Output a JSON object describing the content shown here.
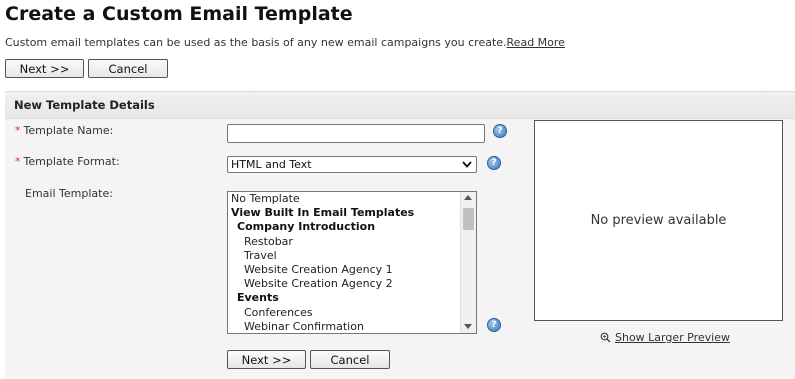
{
  "page": {
    "title": "Create a Custom Email Template",
    "description": "Custom email templates can be used as the basis of any new email campaigns you create.",
    "read_more": "Read More"
  },
  "top_buttons": {
    "next": "Next >>",
    "cancel": "Cancel"
  },
  "panel": {
    "header": "New Template Details"
  },
  "form": {
    "required_mark": "*",
    "template_name_label": "Template Name:",
    "template_name_value": "",
    "template_format_label": "Template Format:",
    "template_format_value": "HTML and Text",
    "email_template_label": "Email Template:",
    "email_template_options": [
      {
        "text": "No Template",
        "type": "item"
      },
      {
        "text": "View Built In Email Templates",
        "type": "group"
      },
      {
        "text": "Company Introduction",
        "type": "subgroup"
      },
      {
        "text": "Restobar",
        "type": "leaf"
      },
      {
        "text": "Travel",
        "type": "leaf"
      },
      {
        "text": "Website Creation Agency 1",
        "type": "leaf"
      },
      {
        "text": "Website Creation Agency 2",
        "type": "leaf"
      },
      {
        "text": "Events",
        "type": "subgroup"
      },
      {
        "text": "Conferences",
        "type": "leaf"
      },
      {
        "text": "Webinar Confirmation",
        "type": "leaf"
      }
    ]
  },
  "preview": {
    "empty_text": "No preview available",
    "larger_link": "Show Larger Preview"
  },
  "bottom_buttons": {
    "next": "Next >>",
    "cancel": "Cancel"
  },
  "icons": {
    "help": "help-icon",
    "zoom": "magnifier-icon"
  },
  "colors": {
    "required": "#cc3333",
    "help_blue": "#3f78b8"
  }
}
